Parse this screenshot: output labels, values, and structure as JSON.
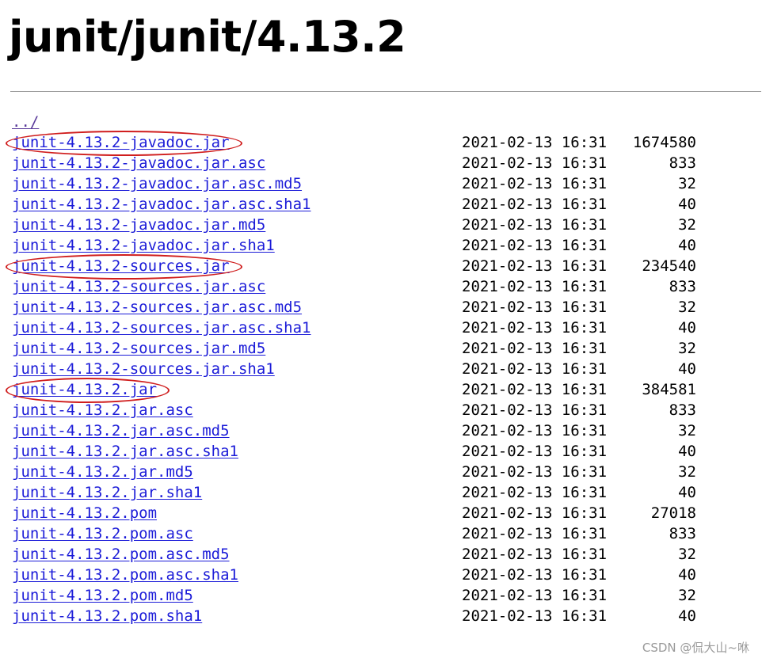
{
  "page": {
    "title": "junit/junit/4.13.2",
    "parent_link": "../"
  },
  "colors": {
    "link": "#1b1bd8",
    "visited_link": "#5a3a9a",
    "highlight": "#d01e1e",
    "rule": "#9a9a9a"
  },
  "entries": [
    {
      "name": "junit-4.13.2-javadoc.jar",
      "date": "2021-02-13 16:31",
      "size": "1674580",
      "highlighted": true
    },
    {
      "name": "junit-4.13.2-javadoc.jar.asc",
      "date": "2021-02-13 16:31",
      "size": "833"
    },
    {
      "name": "junit-4.13.2-javadoc.jar.asc.md5",
      "date": "2021-02-13 16:31",
      "size": "32"
    },
    {
      "name": "junit-4.13.2-javadoc.jar.asc.sha1",
      "date": "2021-02-13 16:31",
      "size": "40"
    },
    {
      "name": "junit-4.13.2-javadoc.jar.md5",
      "date": "2021-02-13 16:31",
      "size": "32"
    },
    {
      "name": "junit-4.13.2-javadoc.jar.sha1",
      "date": "2021-02-13 16:31",
      "size": "40"
    },
    {
      "name": "junit-4.13.2-sources.jar",
      "date": "2021-02-13 16:31",
      "size": "234540",
      "highlighted": true
    },
    {
      "name": "junit-4.13.2-sources.jar.asc",
      "date": "2021-02-13 16:31",
      "size": "833"
    },
    {
      "name": "junit-4.13.2-sources.jar.asc.md5",
      "date": "2021-02-13 16:31",
      "size": "32"
    },
    {
      "name": "junit-4.13.2-sources.jar.asc.sha1",
      "date": "2021-02-13 16:31",
      "size": "40"
    },
    {
      "name": "junit-4.13.2-sources.jar.md5",
      "date": "2021-02-13 16:31",
      "size": "32"
    },
    {
      "name": "junit-4.13.2-sources.jar.sha1",
      "date": "2021-02-13 16:31",
      "size": "40"
    },
    {
      "name": "junit-4.13.2.jar",
      "date": "2021-02-13 16:31",
      "size": "384581",
      "highlighted": true
    },
    {
      "name": "junit-4.13.2.jar.asc",
      "date": "2021-02-13 16:31",
      "size": "833"
    },
    {
      "name": "junit-4.13.2.jar.asc.md5",
      "date": "2021-02-13 16:31",
      "size": "32"
    },
    {
      "name": "junit-4.13.2.jar.asc.sha1",
      "date": "2021-02-13 16:31",
      "size": "40"
    },
    {
      "name": "junit-4.13.2.jar.md5",
      "date": "2021-02-13 16:31",
      "size": "32"
    },
    {
      "name": "junit-4.13.2.jar.sha1",
      "date": "2021-02-13 16:31",
      "size": "40"
    },
    {
      "name": "junit-4.13.2.pom",
      "date": "2021-02-13 16:31",
      "size": "27018"
    },
    {
      "name": "junit-4.13.2.pom.asc",
      "date": "2021-02-13 16:31",
      "size": "833"
    },
    {
      "name": "junit-4.13.2.pom.asc.md5",
      "date": "2021-02-13 16:31",
      "size": "32"
    },
    {
      "name": "junit-4.13.2.pom.asc.sha1",
      "date": "2021-02-13 16:31",
      "size": "40"
    },
    {
      "name": "junit-4.13.2.pom.md5",
      "date": "2021-02-13 16:31",
      "size": "32"
    },
    {
      "name": "junit-4.13.2.pom.sha1",
      "date": "2021-02-13 16:31",
      "size": "40"
    }
  ],
  "watermark": "CSDN @侃大山~咻"
}
